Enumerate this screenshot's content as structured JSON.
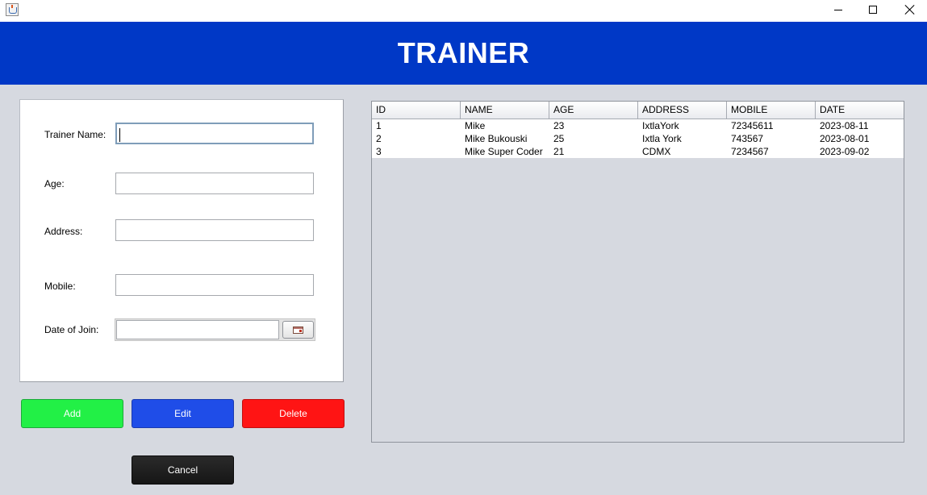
{
  "window": {
    "icon": "java-cup-icon",
    "controls": [
      "minimize-icon",
      "maximize-icon",
      "close-icon"
    ]
  },
  "header": {
    "title": "TRAINER",
    "background": "#0038c6"
  },
  "form": {
    "trainer_name_label": "Trainer Name:",
    "age_label": "Age:",
    "address_label": "Address:",
    "mobile_label": "Mobile:",
    "date_label": "Date of Join:",
    "trainer_name_value": "",
    "age_value": "",
    "address_value": "",
    "mobile_value": "",
    "date_value": "",
    "calendar_icon": "calendar-icon"
  },
  "actions": {
    "add_label": "Add",
    "edit_label": "Edit",
    "delete_label": "Delete",
    "cancel_label": "Cancel",
    "add_color": "#22f046",
    "edit_color": "#1f4de8",
    "delete_color": "#ff1414",
    "cancel_color": "#1c1c1c"
  },
  "table": {
    "columns": [
      "ID",
      "NAME",
      "AGE",
      "ADDRESS",
      "MOBILE",
      "DATE"
    ],
    "rows": [
      [
        "1",
        "Mike",
        "23",
        "IxtlaYork",
        "72345611",
        "2023-08-11"
      ],
      [
        "2",
        "Mike Bukouski",
        "25",
        "Ixtla York",
        "743567",
        "2023-08-01"
      ],
      [
        "3",
        "Mike Super Coder",
        "21",
        "CDMX",
        "7234567",
        "2023-09-02"
      ]
    ]
  }
}
